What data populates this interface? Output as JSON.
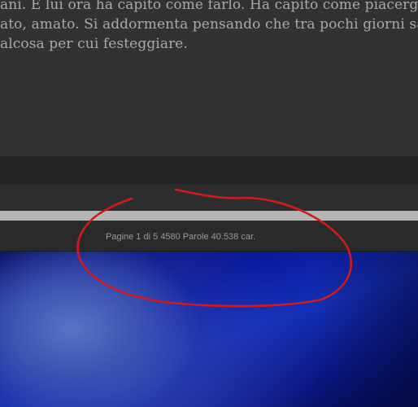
{
  "document": {
    "lines": [
      "ani. E lui ora ha capito come farlo. Ha capito come piacergli. Con",
      "ato, amato. Si addormenta pensando che tra pochi giorni sarà N",
      "alcosa per cui festeggiare."
    ]
  },
  "statusbar": {
    "text": "Pagine 1 di 5   4580 Parole   40.538 car."
  },
  "annotation": {
    "color": "#d11a1a"
  }
}
